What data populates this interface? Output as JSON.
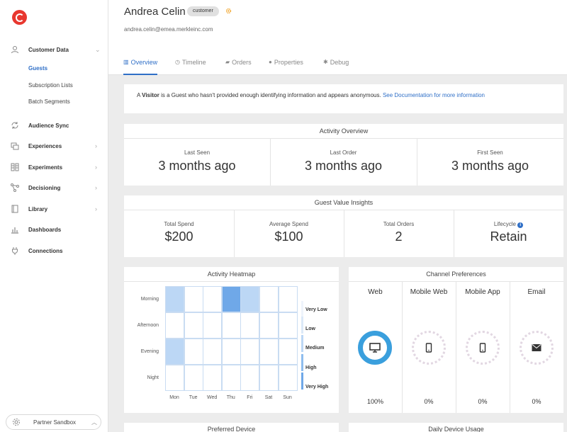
{
  "sidebar": {
    "items": [
      {
        "label": "Customer Data",
        "icon": "person-icon"
      },
      {
        "label": "Audience Sync",
        "icon": "sync-icon"
      },
      {
        "label": "Experiences",
        "icon": "experiences-icon"
      },
      {
        "label": "Experiments",
        "icon": "experiments-icon"
      },
      {
        "label": "Decisioning",
        "icon": "decisioning-icon"
      },
      {
        "label": "Library",
        "icon": "library-icon"
      },
      {
        "label": "Dashboards",
        "icon": "dashboards-icon"
      },
      {
        "label": "Connections",
        "icon": "plug-icon"
      }
    ],
    "subitems": [
      "Guests",
      "Subscription Lists",
      "Batch Segments"
    ],
    "sandbox": "Partner Sandbox"
  },
  "profile": {
    "name": "Andrea Celin",
    "badge": "customer",
    "email": "andrea.celin@emea.merkleinc.com"
  },
  "tabs": [
    "Overview",
    "Timeline",
    "Orders",
    "Properties",
    "Debug"
  ],
  "notice": {
    "prefix": "A ",
    "bold": "Visitor",
    "text": " is a Guest who hasn't provided enough identifying information and appears anonymous. ",
    "link": "See Documentation for more information"
  },
  "activity_overview": {
    "title": "Activity Overview",
    "stats": [
      {
        "label": "Last Seen",
        "value": "3 months ago"
      },
      {
        "label": "Last Order",
        "value": "3 months ago"
      },
      {
        "label": "First Seen",
        "value": "3 months ago"
      }
    ]
  },
  "guest_value": {
    "title": "Guest Value Insights",
    "stats": [
      {
        "label": "Total Spend",
        "value": "$200"
      },
      {
        "label": "Average Spend",
        "value": "$100"
      },
      {
        "label": "Total Orders",
        "value": "2"
      },
      {
        "label": "Lifecycle",
        "value": "Retain"
      }
    ]
  },
  "heatmap": {
    "title": "Activity Heatmap",
    "rows": [
      "Morning",
      "Afternoon",
      "Evening",
      "Night"
    ],
    "cols": [
      "Mon",
      "Tue",
      "Wed",
      "Thu",
      "Fri",
      "Sat",
      "Sun"
    ],
    "levels": [
      [
        2,
        0,
        0,
        4,
        2,
        0,
        0
      ],
      [
        0,
        0,
        0,
        0,
        0,
        0,
        0
      ],
      [
        2,
        0,
        0,
        0,
        0,
        0,
        0
      ],
      [
        0,
        0,
        0,
        0,
        0,
        0,
        0
      ]
    ],
    "legend": [
      "Very Low",
      "Low",
      "Medium",
      "High",
      "Very High"
    ],
    "colors": [
      "#ffffff",
      "#dce9f8",
      "#bcd7f5",
      "#8fbdee",
      "#6fa8e8"
    ]
  },
  "channels": {
    "title": "Channel Preferences",
    "items": [
      {
        "label": "Web",
        "pct": "100%",
        "icon": "monitor-icon"
      },
      {
        "label": "Mobile Web",
        "pct": "0%",
        "icon": "phone-icon"
      },
      {
        "label": "Mobile App",
        "pct": "0%",
        "icon": "phone-icon"
      },
      {
        "label": "Email",
        "pct": "0%",
        "icon": "envelope-icon"
      }
    ]
  },
  "bottom": {
    "preferred_device": "Preferred Device",
    "daily_usage": "Daily Device Usage"
  },
  "colors": {
    "accent": "#2f6fc7",
    "brand": "#e8372f",
    "ring": "#3a9fdd"
  }
}
